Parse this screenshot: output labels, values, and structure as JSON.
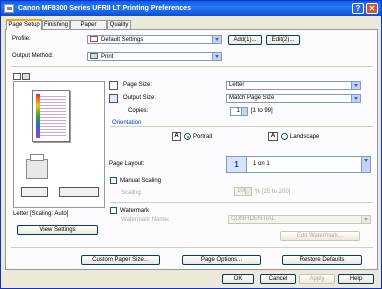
{
  "window": {
    "title": "Canon MF8300 Series UFRII LT Printing Preferences",
    "help_glyph": "?",
    "close_glyph": "✕"
  },
  "tabs": [
    {
      "label": "Page Setup",
      "active": true
    },
    {
      "label": "Finishing"
    },
    {
      "label": "Paper Source"
    },
    {
      "label": "Quality"
    }
  ],
  "profile": {
    "label": "Profile:",
    "value": "Default Settings",
    "add_label": "Add(1)...",
    "edit_label": "Edit(2)..."
  },
  "output_method": {
    "label": "Output Method:",
    "value": "Print"
  },
  "preview": {
    "status": "Letter [Scaling: Auto]",
    "view_settings_label": "View Settings"
  },
  "page_size": {
    "label": "Page Size:",
    "value": "Letter"
  },
  "output_size": {
    "label": "Output Size:",
    "value": "Match Page Size"
  },
  "copies": {
    "label": "Copies:",
    "value": "1",
    "range": "[1 to 99]"
  },
  "orientation": {
    "label": "Orientation",
    "portrait_label": "Portrait",
    "landscape_label": "Landscape",
    "selected": "Portrait",
    "portrait_glyph": "A",
    "landscape_glyph": "A"
  },
  "page_layout": {
    "label": "Page Layout:",
    "value": "1 on 1",
    "icon_digit": "1"
  },
  "manual_scaling": {
    "label": "Manual Scaling",
    "checked": false,
    "scaling_label": "Scaling:",
    "scaling_value": "100",
    "scaling_range": "% [25 to 200]"
  },
  "watermark": {
    "label": "Watermark",
    "checked": false,
    "name_label": "Watermark Name:",
    "name_value": "CONFIDENTIAL",
    "edit_label": "Edit Watermark..."
  },
  "bottom_buttons": {
    "custom_paper_size": "Custom Paper Size...",
    "page_options": "Page Options...",
    "restore_defaults": "Restore Defaults"
  },
  "dialog_buttons": {
    "ok": "OK",
    "cancel": "Cancel",
    "apply": "Apply",
    "help": "Help"
  },
  "colors": {
    "title_bar": "#0a5fe6",
    "tab_highlight": "#f5a31b",
    "face": "#ece9d8",
    "panel": "#fcfcfe"
  }
}
